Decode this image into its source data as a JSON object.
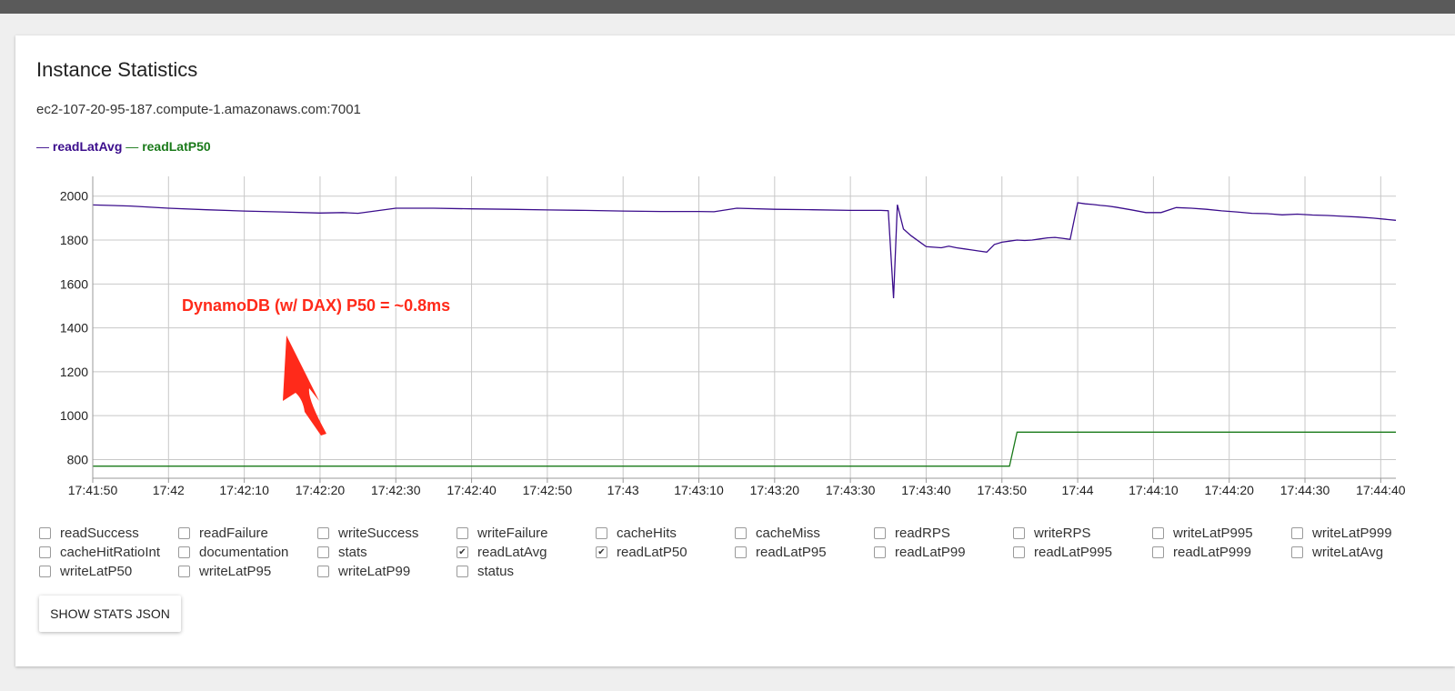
{
  "card": {
    "title": "Instance Statistics",
    "host": "ec2-107-20-95-187.compute-1.amazonaws.com:7001"
  },
  "legend": [
    {
      "label": "readLatAvg",
      "color": "#3b0d8c"
    },
    {
      "label": "readLatP50",
      "color": "#1a7a1a"
    }
  ],
  "annotation": {
    "text": "DynamoDB (w/ DAX) P50 = ~0.8ms",
    "color": "#ff2a1a"
  },
  "checkboxes": [
    {
      "label": "readSuccess",
      "checked": false
    },
    {
      "label": "readFailure",
      "checked": false
    },
    {
      "label": "writeSuccess",
      "checked": false
    },
    {
      "label": "writeFailure",
      "checked": false
    },
    {
      "label": "cacheHits",
      "checked": false
    },
    {
      "label": "cacheMiss",
      "checked": false
    },
    {
      "label": "readRPS",
      "checked": false
    },
    {
      "label": "writeRPS",
      "checked": false
    },
    {
      "label": "writeLatP995",
      "checked": false
    },
    {
      "label": "writeLatP999",
      "checked": false
    },
    {
      "label": "cacheHitRatioInt",
      "checked": false
    },
    {
      "label": "documentation",
      "checked": false
    },
    {
      "label": "stats",
      "checked": false
    },
    {
      "label": "readLatAvg",
      "checked": true
    },
    {
      "label": "readLatP50",
      "checked": true
    },
    {
      "label": "readLatP95",
      "checked": false
    },
    {
      "label": "readLatP99",
      "checked": false
    },
    {
      "label": "readLatP995",
      "checked": false
    },
    {
      "label": "readLatP999",
      "checked": false
    },
    {
      "label": "writeLatAvg",
      "checked": false
    },
    {
      "label": "writeLatP50",
      "checked": false
    },
    {
      "label": "writeLatP95",
      "checked": false
    },
    {
      "label": "writeLatP99",
      "checked": false
    },
    {
      "label": "status",
      "checked": false
    }
  ],
  "button": {
    "label": "SHOW STATS JSON"
  },
  "chart_data": {
    "type": "line",
    "title": "",
    "xlabel": "",
    "ylabel": "",
    "x_tick_labels": [
      "17:41:50",
      "17:42",
      "17:42:10",
      "17:42:20",
      "17:42:30",
      "17:42:40",
      "17:42:50",
      "17:43",
      "17:43:10",
      "17:43:20",
      "17:43:30",
      "17:43:40",
      "17:43:50",
      "17:44",
      "17:44:10",
      "17:44:20",
      "17:44:30",
      "17:44:40"
    ],
    "xlim_seconds_after_17_41_50": [
      0,
      172
    ],
    "y_ticks": [
      800,
      1000,
      1200,
      1400,
      1600,
      1800,
      2000
    ],
    "ylim": [
      715,
      2090
    ],
    "grid": true,
    "legend_position": "top-left",
    "series": [
      {
        "name": "readLatAvg",
        "color": "#3b0d8c",
        "x": [
          0,
          5,
          10,
          15,
          20,
          25,
          30,
          33,
          35,
          40,
          45,
          50,
          55,
          60,
          65,
          70,
          75,
          80,
          82,
          85,
          90,
          95,
          100,
          104,
          105,
          105.7,
          106.2,
          107,
          108,
          110,
          112,
          113,
          114,
          115,
          116,
          117,
          118,
          119,
          120,
          121,
          122,
          123,
          124,
          125,
          126,
          127,
          128,
          129,
          130,
          131,
          132,
          133,
          134,
          135,
          137,
          139,
          141,
          143,
          145,
          147,
          149,
          151,
          153,
          155,
          157,
          159,
          161,
          163,
          165,
          167,
          169,
          172
        ],
        "y": [
          1960,
          1955,
          1945,
          1938,
          1932,
          1928,
          1923,
          1925,
          1922,
          1945,
          1945,
          1942,
          1940,
          1937,
          1935,
          1932,
          1930,
          1930,
          1929,
          1945,
          1940,
          1938,
          1935,
          1935,
          1934,
          1535,
          1961,
          1850,
          1820,
          1770,
          1765,
          1772,
          1765,
          1760,
          1755,
          1750,
          1745,
          1780,
          1790,
          1795,
          1800,
          1798,
          1800,
          1805,
          1810,
          1812,
          1808,
          1803,
          1970,
          1965,
          1962,
          1958,
          1955,
          1950,
          1938,
          1925,
          1925,
          1948,
          1945,
          1940,
          1933,
          1928,
          1922,
          1920,
          1915,
          1918,
          1914,
          1912,
          1908,
          1905,
          1900,
          1890
        ]
      },
      {
        "name": "readLatP50",
        "color": "#1a7a1a",
        "x": [
          0,
          121,
          122,
          172
        ],
        "y": [
          770,
          770,
          925,
          925
        ]
      }
    ]
  }
}
